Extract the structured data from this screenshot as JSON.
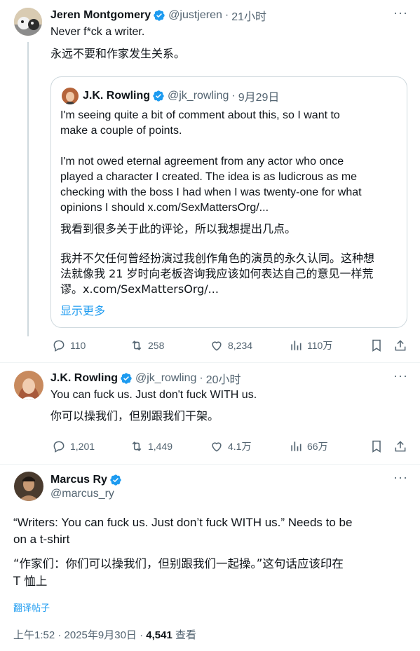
{
  "tweet1": {
    "name": "Jeren Montgomery",
    "handle": "@justjeren",
    "sep": "·",
    "time": "21小时",
    "text": "Never f*ck a writer.",
    "translation": "永远不要和作家发生关系。",
    "quote": {
      "name": "J.K. Rowling",
      "handle": "@jk_rowling",
      "sep": "·",
      "time": "9月29日",
      "para1_line1": "I'm seeing quite a bit of comment about this, so I want to",
      "para1_line2": "make a couple of points.",
      "para2_line1": "I'm not owed eternal agreement from any actor who once",
      "para2_line2": "played a character I created. The idea is as ludicrous as me",
      "para2_line3": "checking with the boss I had when I was twenty-one for what",
      "para2_line4": "opinions I should x.com/SexMattersOrg/...",
      "cn1": "我看到很多关于此的评论，所以我想提出几点。",
      "cn2_line1": "我并不欠任何曾经扮演过我创作角色的演员的永久认同。这种想",
      "cn2_line2": "法就像我 21 岁时向老板咨询我应该如何表达自己的意见一样荒",
      "cn2_line3": "谬。x.com/SexMattersOrg/...",
      "show_more": "显示更多"
    },
    "replies": "110",
    "retweets": "258",
    "likes": "8,234",
    "views": "110万"
  },
  "tweet2": {
    "name": "J.K. Rowling",
    "handle": "@jk_rowling",
    "sep": "·",
    "time": "20小时",
    "text": "You can fuck us. Just don't fuck WITH us.",
    "translation": "你可以操我们，但别跟我们干架。",
    "replies": "1,201",
    "retweets": "1,449",
    "likes": "4.1万",
    "views": "66万"
  },
  "tweet3": {
    "name": "Marcus Ry",
    "handle": "@marcus_ry",
    "line1": "“Writers: You can fuck us. Just don’t fuck WITH us.” Needs to be",
    "line2": "on a t-shirt",
    "cn_line1": "“作家们：你们可以操我们，但别跟我们一起操。”这句话应该印在",
    "cn_line2": "T 恤上",
    "translate_label": "翻译帖子",
    "timestamp": "上午1:52 · 2025年9月30日 · ",
    "view_count": "4,541",
    "views_label": " 查看"
  },
  "colors": {
    "accent": "#1d9bf0",
    "secondary_text": "#536471",
    "border": "#cfd9de"
  },
  "icons": [
    "verified-badge-icon",
    "more-icon",
    "reply-icon",
    "retweet-icon",
    "like-icon",
    "views-icon",
    "bookmark-icon",
    "share-icon"
  ]
}
